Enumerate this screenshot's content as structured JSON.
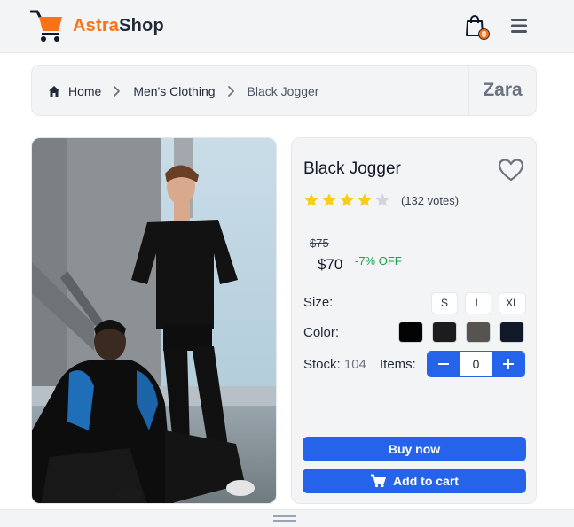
{
  "header": {
    "logo_part1": "Astra",
    "logo_part2": "Shop",
    "cart_count": "0"
  },
  "breadcrumb": {
    "items": [
      "Home",
      "Men's Clothing",
      "Black Jogger"
    ],
    "brand": "Zara"
  },
  "product": {
    "title": "Black Jogger",
    "rating": 4,
    "rating_max": 5,
    "votes": "(132 votes)",
    "old_price": "$75",
    "price": "$70",
    "discount": "-7% OFF",
    "size_label": "Size:",
    "sizes": [
      "S",
      "L",
      "XL"
    ],
    "color_label": "Color:",
    "colors": [
      "#030303",
      "#1c1c1c",
      "#57534e",
      "#111827"
    ],
    "stock_label": "Stock:",
    "stock_value": "104",
    "items_label": "Items:",
    "quantity": "0",
    "buy_label": "Buy now",
    "cart_label": "Add to cart"
  },
  "colors": {
    "accent": "#2563eb",
    "brand_orange": "#f97316",
    "discount_green": "#16a34a",
    "star": "#facc15",
    "star_empty": "#d1d5db"
  }
}
